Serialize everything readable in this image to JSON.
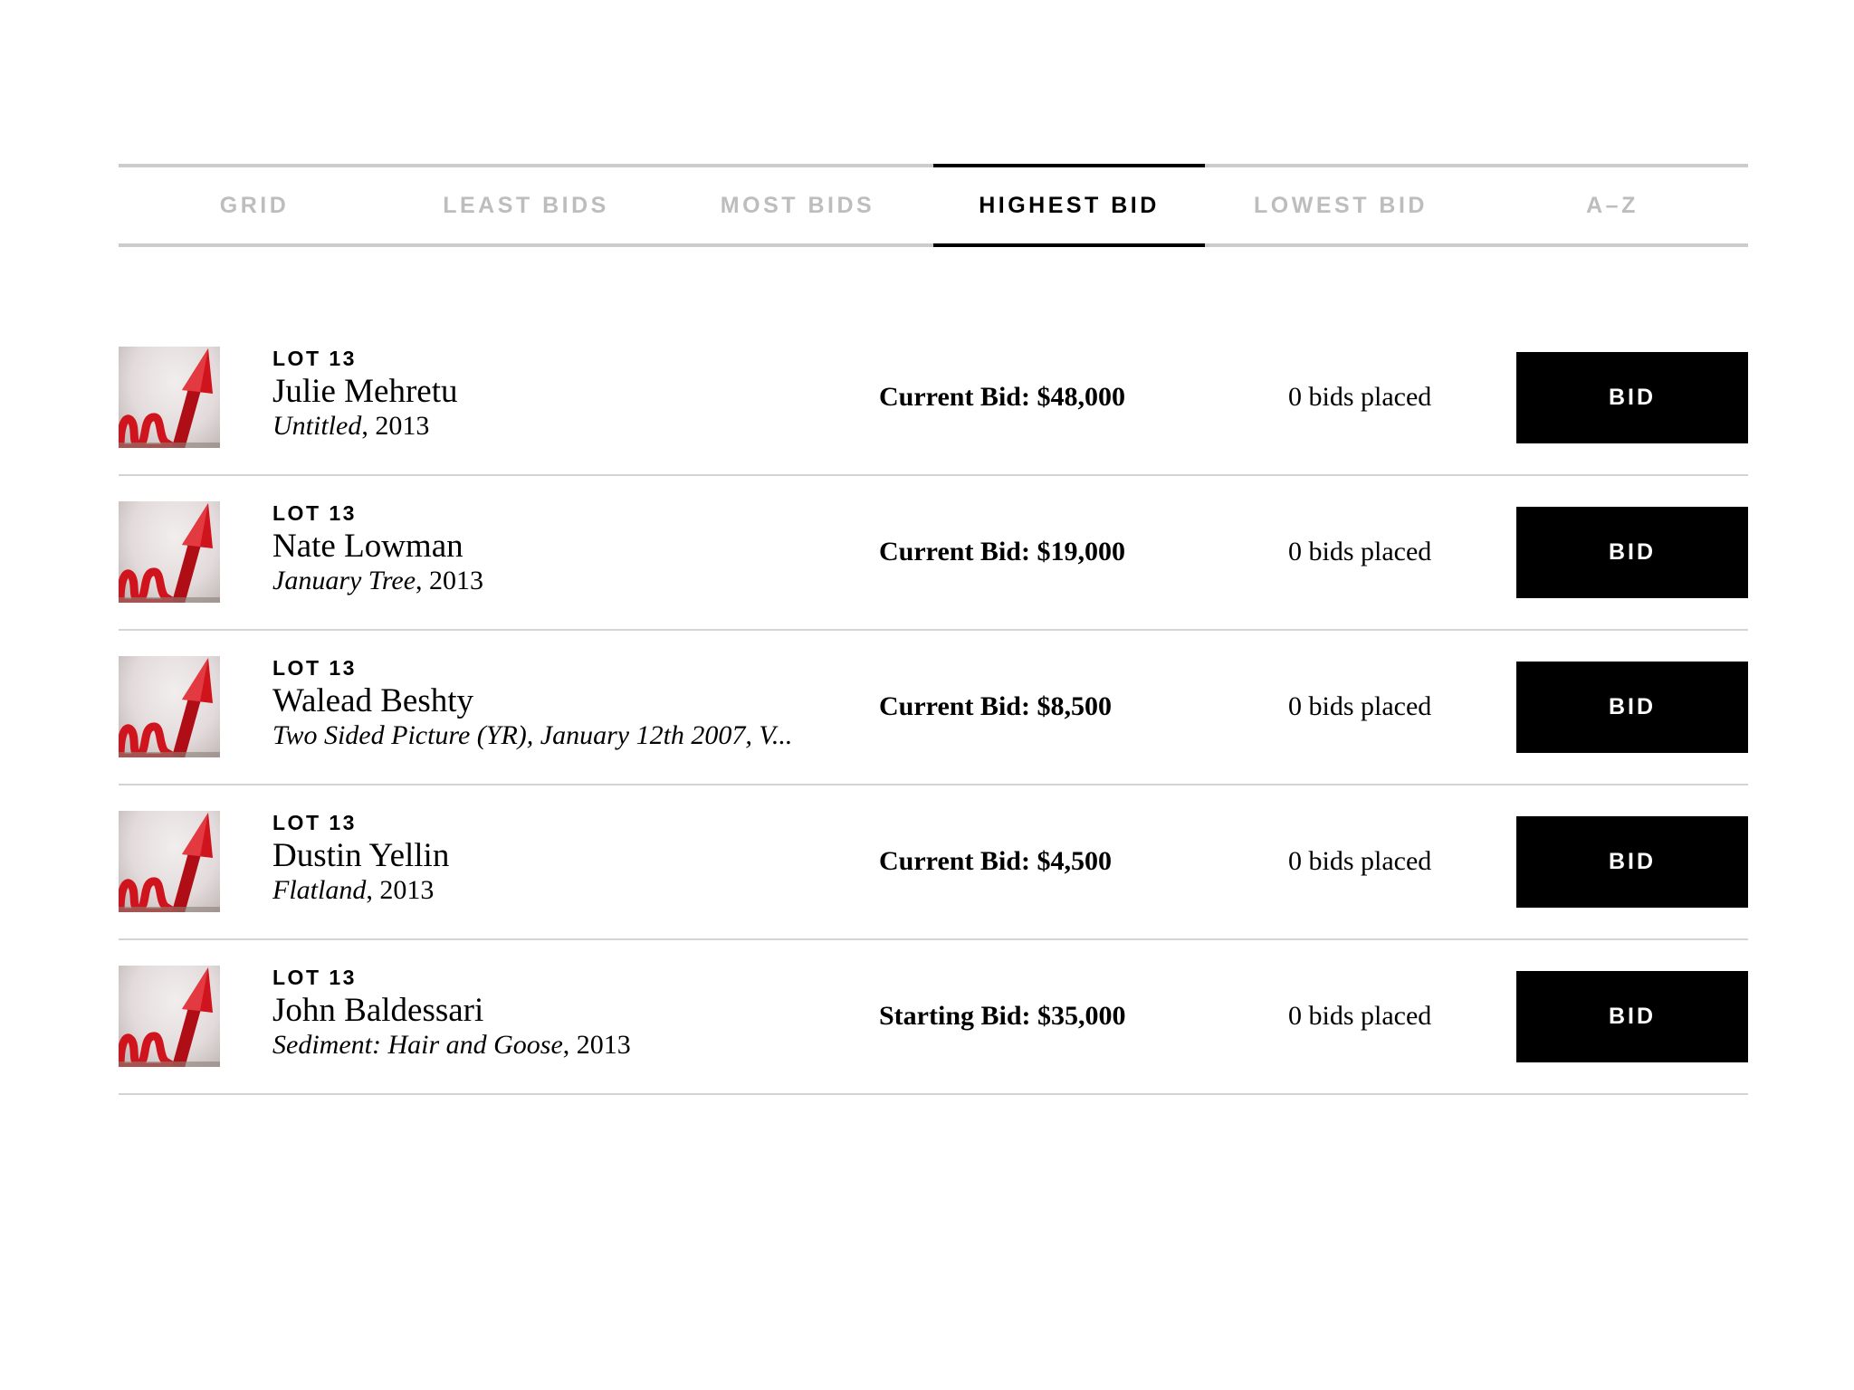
{
  "sort_tabs": [
    {
      "label": "GRID"
    },
    {
      "label": "LEAST BIDS"
    },
    {
      "label": "MOST BIDS"
    },
    {
      "label": "HIGHEST BID"
    },
    {
      "label": "LOWEST BID"
    },
    {
      "label": "A–Z"
    }
  ],
  "active_tab": "HIGHEST BID",
  "lots": [
    {
      "lot_label": "LOT 13",
      "artist": "Julie Mehretu",
      "work_title": "Untitled",
      "work_suffix": ", 2013",
      "bid_text": "Current Bid: $48,000",
      "bids_placed": "0 bids placed",
      "button_label": "BID"
    },
    {
      "lot_label": "LOT 13",
      "artist": "Nate Lowman",
      "work_title": "January Tree",
      "work_suffix": ", 2013",
      "bid_text": "Current Bid: $19,000",
      "bids_placed": "0 bids placed",
      "button_label": "BID"
    },
    {
      "lot_label": "LOT 13",
      "artist": "Walead Beshty",
      "work_title": "Two Sided Picture (YR), January 12th 2007, V...",
      "work_suffix": "",
      "bid_text": "Current Bid: $8,500",
      "bids_placed": "0 bids placed",
      "button_label": "BID"
    },
    {
      "lot_label": "LOT 13",
      "artist": "Dustin Yellin",
      "work_title": "Flatland",
      "work_suffix": ", 2013",
      "bid_text": "Current Bid: $4,500",
      "bids_placed": "0 bids placed",
      "button_label": "BID"
    },
    {
      "lot_label": "LOT 13",
      "artist": "John Baldessari",
      "work_title": "Sediment: Hair and Goose",
      "work_suffix": ", 2013",
      "bid_text": "Starting Bid: $35,000",
      "bids_placed": "0 bids placed",
      "button_label": "BID"
    }
  ],
  "colors": {
    "active_tab": "#000000",
    "inactive_tab": "#bdbdbd",
    "divider": "#d4d4d4",
    "button_bg": "#000000",
    "button_text": "#ffffff",
    "thumb_arrow": "#d0141d"
  },
  "icons": {
    "thumbnail": "red-rising-arrow-image"
  }
}
